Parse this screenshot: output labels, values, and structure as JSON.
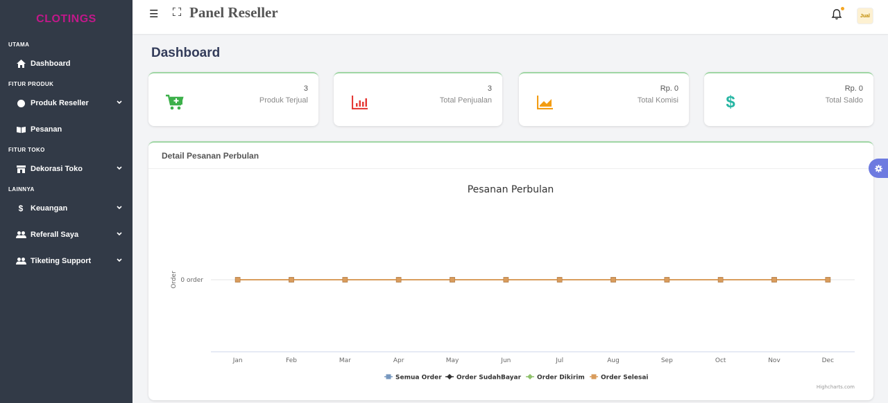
{
  "brand": {
    "logo_text": "CLOTINGS"
  },
  "header": {
    "title": "Panel Reseller",
    "hamburger_icon": "menu-icon",
    "fullscreen_icon": "fullscreen-icon",
    "bell_icon": "bell-icon",
    "avatar_text": "Jual",
    "notification_color": "#f4a623"
  },
  "sidebar": {
    "sections": [
      {
        "title": "UTAMA",
        "items": [
          {
            "label": "Dashboard",
            "icon": "home-icon",
            "has_chevron": false
          }
        ]
      },
      {
        "title": "FITUR PRODUK",
        "items": [
          {
            "label": "Produk Reseller",
            "icon": "circle-icon",
            "has_chevron": true
          },
          {
            "label": "Pesanan",
            "icon": "book-icon",
            "has_chevron": false
          }
        ]
      },
      {
        "title": "FITUR TOKO",
        "items": [
          {
            "label": "Dekorasi Toko",
            "icon": "store-icon",
            "has_chevron": true
          }
        ]
      },
      {
        "title": "LAINNYA",
        "items": [
          {
            "label": "Keuangan",
            "icon": "dollar-icon",
            "has_chevron": true
          },
          {
            "label": "Referall Saya",
            "icon": "users-icon",
            "has_chevron": true
          },
          {
            "label": "Tiketing Support",
            "icon": "users-icon",
            "has_chevron": true
          }
        ]
      }
    ]
  },
  "page": {
    "title": "Dashboard"
  },
  "stats": [
    {
      "value": "3",
      "label": "Produk Terjual",
      "icon": "cart-plus-icon",
      "color": "#3cb04a"
    },
    {
      "value": "3",
      "label": "Total Penjualan",
      "icon": "bar-chart-icon",
      "color": "#e53935"
    },
    {
      "value": "Rp. 0",
      "label": "Total Komisi",
      "icon": "trend-chart-icon",
      "color": "#f39c12"
    },
    {
      "value": "Rp. 0",
      "label": "Total Saldo",
      "icon": "dollar-icon",
      "color": "#26b5a3"
    }
  ],
  "panel": {
    "title": "Detail Pesanan Perbulan"
  },
  "chart_data": {
    "type": "line",
    "title": "Pesanan Perbulan",
    "ylabel": "Order",
    "ytick_label": "0 order",
    "categories": [
      "Jan",
      "Feb",
      "Mar",
      "Apr",
      "May",
      "Jun",
      "Jul",
      "Aug",
      "Sep",
      "Oct",
      "Nov",
      "Dec"
    ],
    "series": [
      {
        "name": "Semua Order",
        "values": [
          0,
          0,
          0,
          0,
          0,
          0,
          0,
          0,
          0,
          0,
          0,
          0
        ],
        "color": "#7798bf",
        "marker": "square"
      },
      {
        "name": "Order SudahBayar",
        "values": [
          0,
          0,
          0,
          0,
          0,
          0,
          0,
          0,
          0,
          0,
          0,
          0
        ],
        "color": "#333333",
        "marker": "diamond"
      },
      {
        "name": "Order Dikirim",
        "values": [
          0,
          0,
          0,
          0,
          0,
          0,
          0,
          0,
          0,
          0,
          0,
          0
        ],
        "color": "#90c26c",
        "marker": "diamond"
      },
      {
        "name": "Order Selesai",
        "values": [
          0,
          0,
          0,
          0,
          0,
          0,
          0,
          0,
          0,
          0,
          0,
          0
        ],
        "color": "#d99c5c",
        "marker": "square"
      }
    ],
    "legend": "bottom",
    "credits": "Highcharts.com"
  }
}
